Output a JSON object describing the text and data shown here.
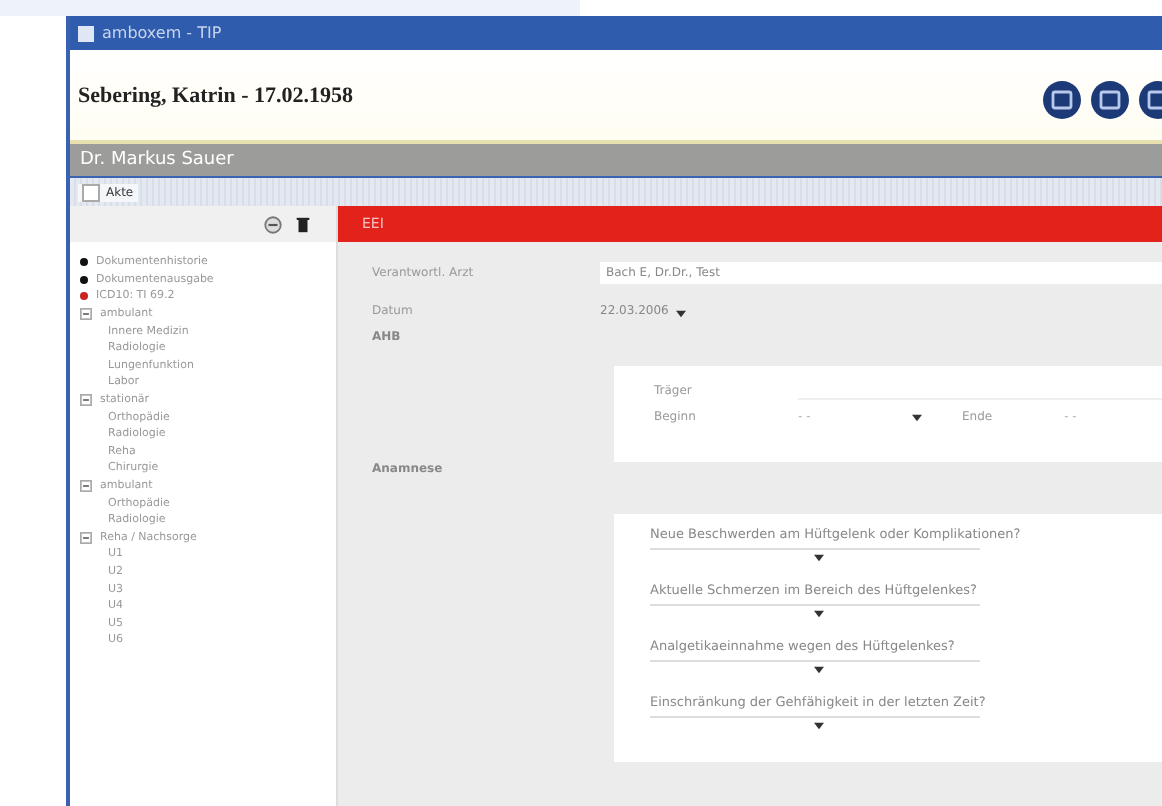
{
  "window": {
    "title": "amboxem - TIP"
  },
  "patient": {
    "name": "Sebering, Katrin - 17.02.1958"
  },
  "user_bar": {
    "name": "Dr. Markus Sauer"
  },
  "tabs": [
    {
      "label": "Akte",
      "selected": true
    }
  ],
  "sidebar": {
    "items": [
      {
        "kind": "link",
        "label": "Dokumentenhistorie",
        "color": "#111111"
      },
      {
        "kind": "link",
        "label": "Dokumentenausgabe",
        "color": "#111111"
      },
      {
        "kind": "link",
        "label": "ICD10: TI 69.2",
        "color": "#cc2222"
      },
      {
        "kind": "group",
        "label": "ambulant",
        "expanded": true,
        "children": [
          {
            "label": "Innere Medizin"
          },
          {
            "label": "Radiologie"
          },
          {
            "label": "Lungenfunktion"
          },
          {
            "label": "Labor"
          }
        ]
      },
      {
        "kind": "group",
        "label": "stationär",
        "expanded": true,
        "children": [
          {
            "label": "Orthopädie"
          },
          {
            "label": "Radiologie"
          },
          {
            "label": "Reha"
          },
          {
            "label": "Chirurgie"
          }
        ]
      },
      {
        "kind": "group",
        "label": "ambulant",
        "expanded": true,
        "children": [
          {
            "label": "Orthopädie"
          },
          {
            "label": "Radiologie"
          }
        ]
      },
      {
        "kind": "group",
        "label": "Reha / Nachsorge",
        "expanded": true,
        "children": [
          {
            "label": "U1"
          },
          {
            "label": "U2"
          },
          {
            "label": "U3"
          },
          {
            "label": "U4"
          },
          {
            "label": "U5"
          },
          {
            "label": "U6"
          }
        ]
      }
    ]
  },
  "form": {
    "title": "EEI",
    "fields": [
      {
        "label": "Verantwortl. Arzt",
        "value": "Bach E, Dr.Dr., Test"
      },
      {
        "label": "Datum",
        "value": "22.03.2006"
      }
    ],
    "ahb": {
      "label": "AHB",
      "traeger": "Träger",
      "beginn": "Beginn",
      "beginn_value": "- -",
      "ende": "Ende",
      "ende_value": "- -"
    },
    "anamnese": {
      "label": "Anamnese",
      "questions": [
        "Neue Beschwerden am Hüftgelenk oder Komplikationen?",
        "Aktuelle Schmerzen im Bereich des Hüftgelenkes?",
        "Analgetikaeinnahme wegen des Hüftgelenkes?",
        "Einschränkung der Gehfähigkeit in der letzten Zeit?"
      ]
    }
  }
}
